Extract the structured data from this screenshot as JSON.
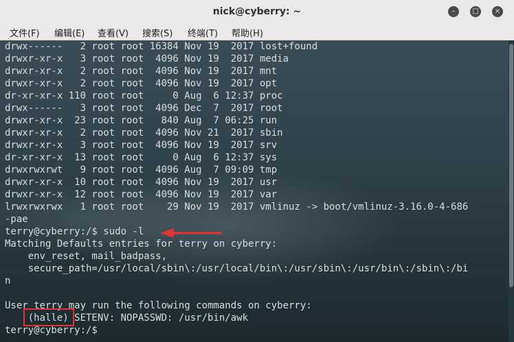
{
  "window": {
    "title": "nick@cyberry: ~",
    "buttons": {
      "minimize": "–",
      "maximize": "□",
      "close": "×"
    }
  },
  "menu": [
    "文件(F)",
    "编辑(E)",
    "查看(V)",
    "搜索(S)",
    "终端(T)",
    "帮助(H)"
  ],
  "terminal": {
    "lines": [
      "drwx------   2 root root 16384 Nov 19  2017 lost+found",
      "drwxr-xr-x   3 root root  4096 Nov 19  2017 media",
      "drwxr-xr-x   2 root root  4096 Nov 19  2017 mnt",
      "drwxr-xr-x   2 root root  4096 Nov 19  2017 opt",
      "dr-xr-xr-x 110 root root     0 Aug  6 12:37 proc",
      "drwx------   3 root root  4096 Dec  7  2017 root",
      "drwxr-xr-x  23 root root   840 Aug  7 06:25 run",
      "drwxr-xr-x   2 root root  4096 Nov 21  2017 sbin",
      "drwxr-xr-x   3 root root  4096 Nov 19  2017 srv",
      "dr-xr-xr-x  13 root root     0 Aug  6 12:37 sys",
      "drwxrwxrwt   9 root root  4096 Aug  7 09:09 tmp",
      "drwxr-xr-x  10 root root  4096 Nov 19  2017 usr",
      "drwxr-xr-x  12 root root  4096 Nov 19  2017 var",
      "lrwxrwxrwx   1 root root    29 Nov 19  2017 vmlinuz -> boot/vmlinuz-3.16.0-4-686",
      "-pae",
      "terry@cyberry:/$ sudo -l",
      "Matching Defaults entries for terry on cyberry:",
      "    env_reset, mail_badpass,",
      "    secure_path=/usr/local/sbin\\:/usr/local/bin\\:/usr/sbin\\:/usr/bin\\:/sbin\\:/bi",
      "n",
      "",
      "User terry may run the following commands on cyberry:",
      "    (halle) SETENV: NOPASSWD: /usr/bin/awk",
      "terry@cyberry:/$"
    ]
  },
  "colors": {
    "annotation": "#e23434",
    "terminal_text": "#d9dede",
    "titlebar": "#e9e9e9"
  }
}
